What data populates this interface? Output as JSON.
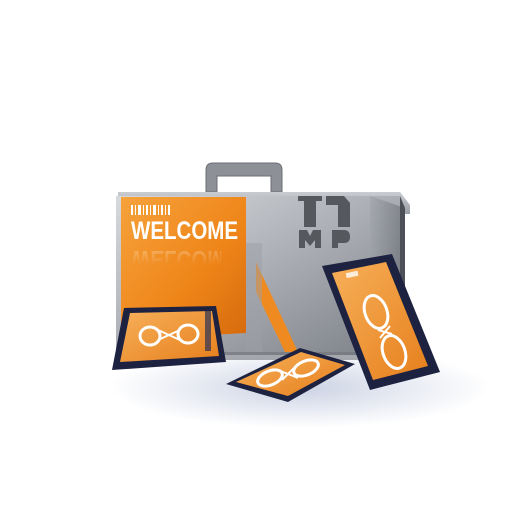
{
  "scene": {
    "description_kind": "product-render"
  },
  "case": {
    "label_text": "WELCOME",
    "brand_lettering": "MP",
    "colors": {
      "body_silver": "#b9bcc2",
      "body_dark": "#6f737a",
      "accent_orange": "#f08a1c",
      "orange_dark": "#c8620a",
      "handle": "#8d9096"
    }
  },
  "cards": {
    "count": 3,
    "colors": {
      "frame": "#1d2240",
      "insert_orange": "#f29a3a",
      "ring": "#ffffff"
    }
  }
}
